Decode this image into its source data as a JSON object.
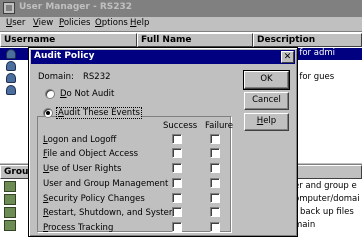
{
  "window": {
    "title": "User Manager - RS232"
  },
  "menu": {
    "items": [
      {
        "label_u": "U",
        "label_rest": "ser"
      },
      {
        "label_u": "V",
        "label_rest": "iew"
      },
      {
        "label_u": "P",
        "label_rest": "olicies"
      },
      {
        "label_u": "O",
        "label_rest": "ptions"
      },
      {
        "label_u": "H",
        "label_rest": "elp"
      }
    ]
  },
  "users_pane": {
    "columns": {
      "username": "Username",
      "full_name": "Full Name",
      "description": "Description"
    },
    "rows": [
      {
        "initial": "A",
        "description": "ccount for admi"
      },
      {
        "initial": "G",
        "description": "ccount for gues"
      }
    ]
  },
  "groups_pane": {
    "header": "Grou",
    "rows": [
      {
        "initial": "A",
        "description": "er and group e"
      },
      {
        "initial": "",
        "description": "omputer/domai"
      },
      {
        "initial": "",
        "description": "back up files"
      },
      {
        "initial": "",
        "description": "main"
      }
    ]
  },
  "dialog": {
    "title": "Audit Policy",
    "close_glyph": "✕",
    "domain_label": "Domain:",
    "domain_value": "RS232",
    "do_not_audit_u": "D",
    "do_not_audit_rest": "o Not Audit",
    "audit_events_u": "A",
    "audit_events_rest": "udit These Events",
    "col_success": "Success",
    "col_failure": "Failure",
    "events": [
      {
        "u": "L",
        "rest": "ogon and Logoff",
        "success": false,
        "failure": false
      },
      {
        "u": "F",
        "rest": "ile and Object Access",
        "success": false,
        "failure": false
      },
      {
        "u": "U",
        "rest": "se of User Rights",
        "success": false,
        "failure": false
      },
      {
        "u": "",
        "rest": "User and Group Management",
        "success": false,
        "failure": false
      },
      {
        "u": "S",
        "rest": "ecurity Policy Changes",
        "success": false,
        "failure": false
      },
      {
        "u": "R",
        "rest": "estart, Shutdown, and System",
        "success": false,
        "failure": false
      },
      {
        "u": "P",
        "rest": "rocess Tracking",
        "success": false,
        "failure": false
      }
    ],
    "buttons": {
      "ok": "OK",
      "cancel": "Cancel",
      "help_u": "H",
      "help_rest": "elp"
    }
  }
}
